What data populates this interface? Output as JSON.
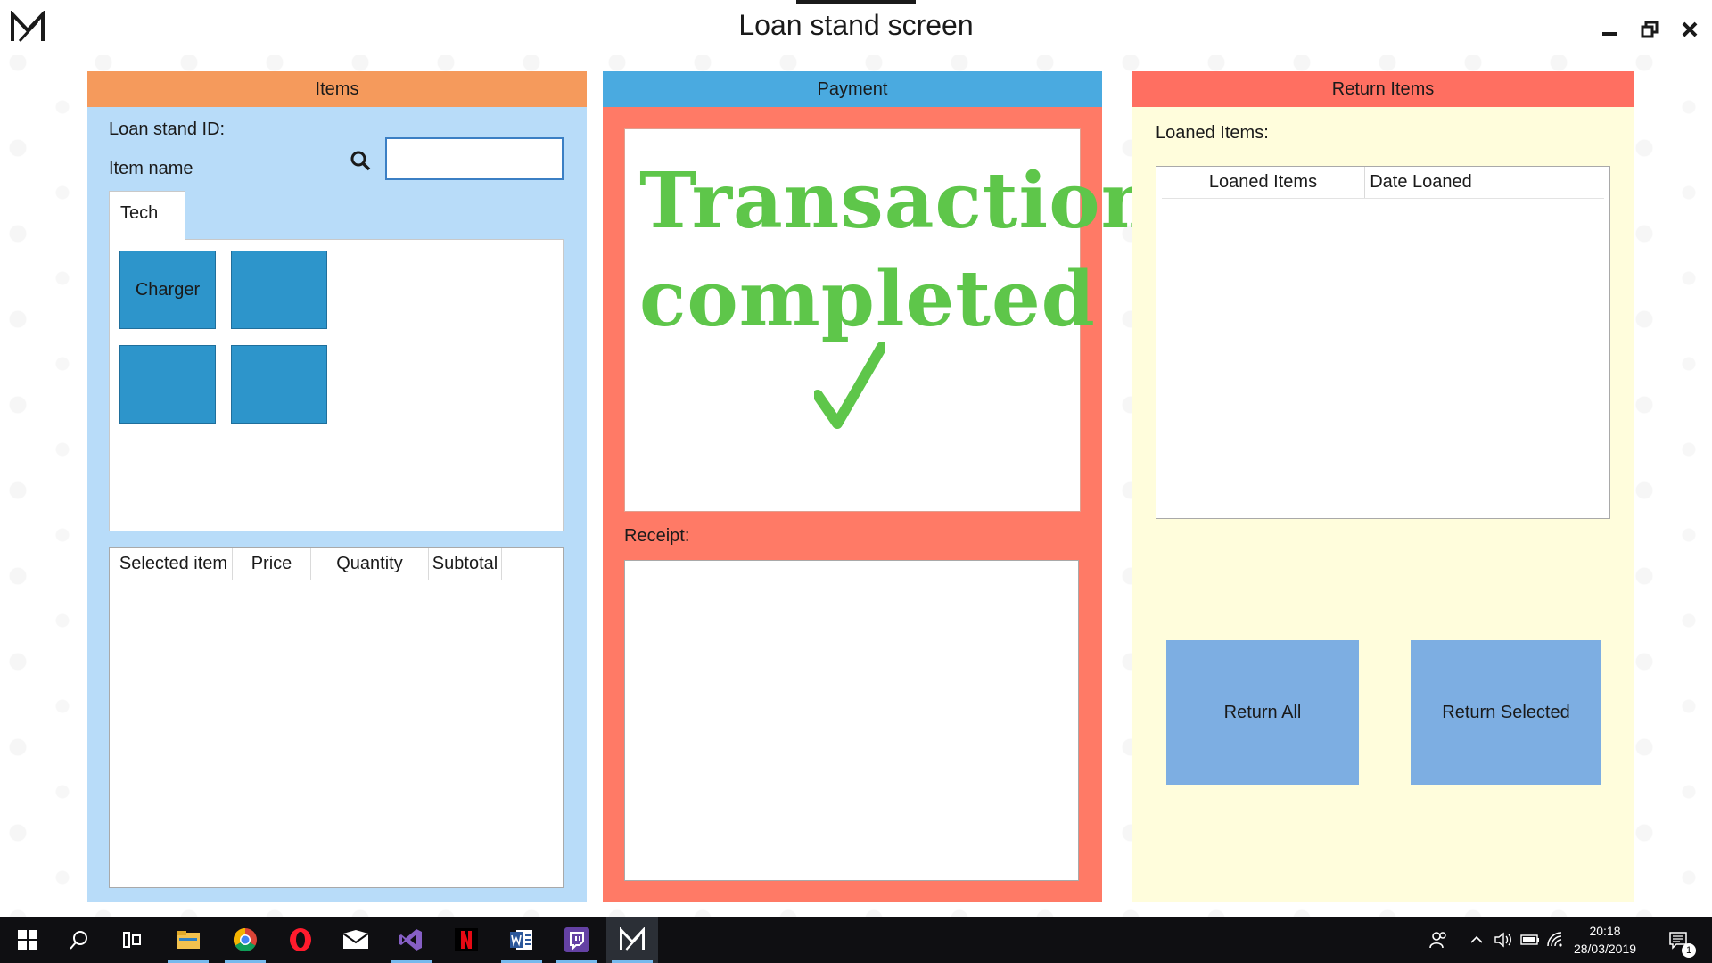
{
  "window": {
    "title": "Loan stand screen",
    "icons": [
      "app-logo-icon",
      "minimize-icon",
      "restore-icon",
      "close-icon"
    ]
  },
  "items_panel": {
    "header": "Items",
    "loan_stand_id_label": "Loan stand ID:",
    "item_name_label": "Item name",
    "search_value": "",
    "search_placeholder": "",
    "tab_label": "Tech",
    "tiles": [
      "Charger",
      "",
      "",
      ""
    ],
    "selected_list": {
      "columns": [
        "Selected item",
        "Price",
        "Quantity",
        "Subtotal"
      ],
      "rows": []
    }
  },
  "payment_panel": {
    "header": "Payment",
    "transaction_line1": "Transaction",
    "transaction_line2": "completed",
    "receipt_label": "Receipt:",
    "receipt_text": ""
  },
  "return_panel": {
    "header": "Return Items",
    "loaned_label": "Loaned Items:",
    "loaned_list": {
      "columns": [
        "Loaned Items",
        "Date Loaned"
      ],
      "rows": []
    },
    "return_all_label": "Return All",
    "return_selected_label": "Return Selected"
  },
  "taskbar": {
    "apps": [
      "start-icon",
      "search-icon",
      "task-view-icon",
      "file-explorer-icon",
      "chrome-icon",
      "opera-icon",
      "mail-icon",
      "visual-studio-icon",
      "netflix-icon",
      "word-icon",
      "twitch-icon",
      "loan-stand-app-icon"
    ],
    "time": "20:18",
    "date": "28/03/2019",
    "notification_count": "1"
  },
  "colors": {
    "items_header": "#f59a5c",
    "items_bg": "#b8dcf9",
    "tile": "#2d95cb",
    "payment_header": "#4aaae0",
    "payment_bg": "#ff7a66",
    "transaction_text": "#5ec64a",
    "return_header": "#ff6f61",
    "return_bg": "#fffddc",
    "return_button": "#7daee2"
  }
}
